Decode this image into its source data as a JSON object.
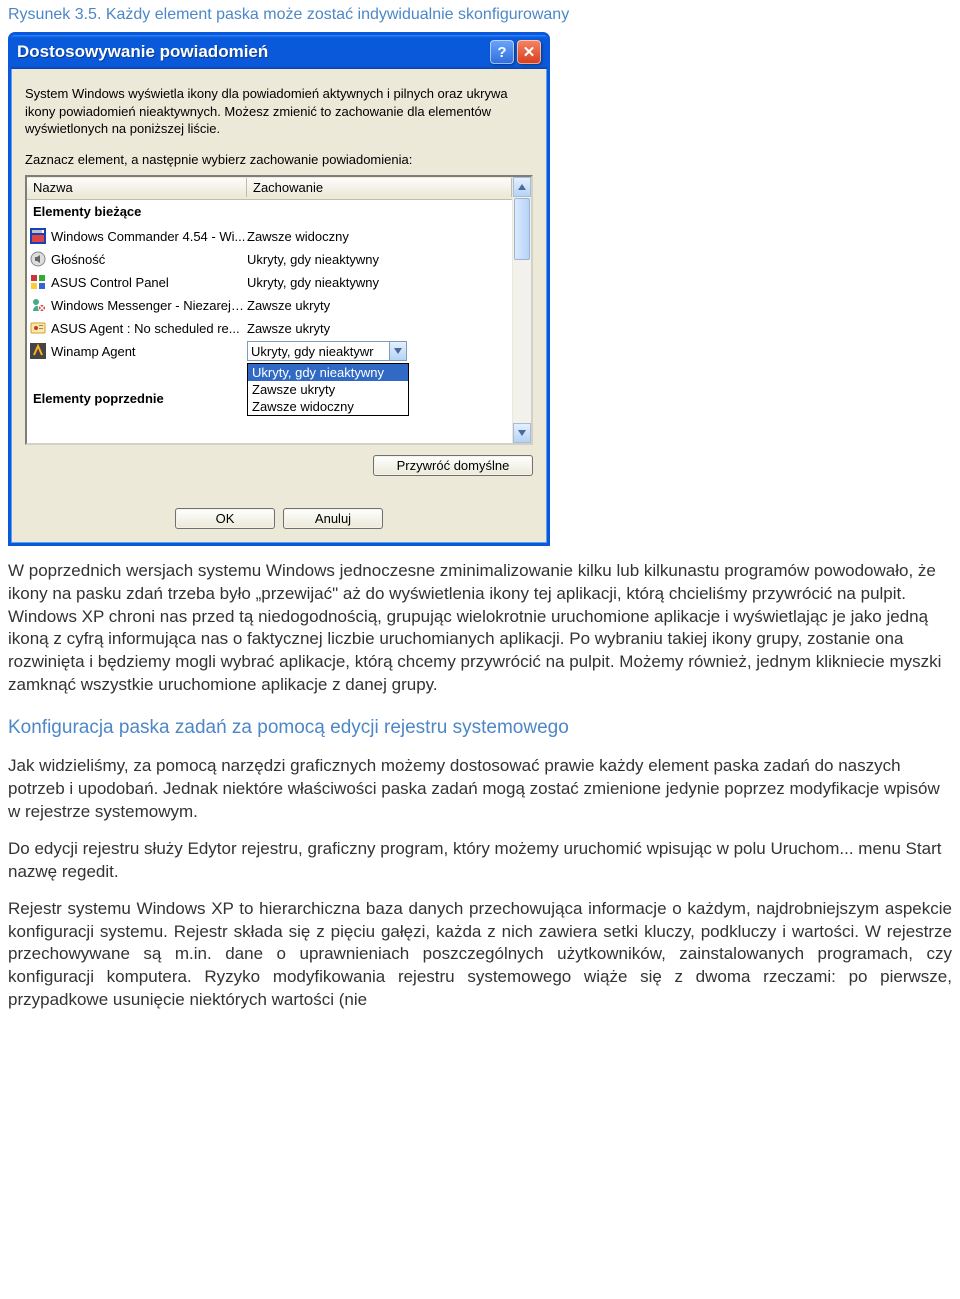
{
  "caption": "Rysunek 3.5. Każdy element paska może zostać indywidualnie skonfigurowany",
  "dialog": {
    "title": "Dostosowywanie powiadomień",
    "description": "System Windows wyświetla ikony dla powiadomień aktywnych i pilnych oraz ukrywa ikony powiadomień nieaktywnych. Możesz zmienić to zachowanie dla elementów wyświetlonych na poniższej liście.",
    "instruction": "Zaznacz element, a następnie wybierz zachowanie powiadomienia:",
    "columns": {
      "name": "Nazwa",
      "behavior": "Zachowanie"
    },
    "sections": {
      "current": "Elementy bieżące",
      "previous": "Elementy poprzednie"
    },
    "items": [
      {
        "name": "Windows Commander 4.54 - Wi...",
        "behavior": "Zawsze widoczny"
      },
      {
        "name": "Głośność",
        "behavior": "Ukryty, gdy nieaktywny"
      },
      {
        "name": "ASUS Control Panel",
        "behavior": "Ukryty, gdy nieaktywny"
      },
      {
        "name": "Windows Messenger - Niezareje...",
        "behavior": "Zawsze ukryty"
      },
      {
        "name": "ASUS Agent : No scheduled re...",
        "behavior": "Zawsze ukryty"
      },
      {
        "name": "Winamp Agent",
        "behavior": "Ukryty, gdy nieaktywr"
      }
    ],
    "dropdown_options": [
      "Ukryty, gdy nieaktywny",
      "Zawsze ukryty",
      "Zawsze widoczny"
    ],
    "restore_button": "Przywróć domyślne",
    "ok_button": "OK",
    "cancel_button": "Anuluj"
  },
  "article": {
    "p1": "W poprzednich wersjach systemu Windows jednoczesne zminimalizowanie kilku lub kilkunastu programów powodowało, że ikony na pasku zdań trzeba było „przewijać\" aż do wyświetlenia ikony tej aplikacji, którą chcieliśmy przywrócić na pulpit. Windows XP chroni nas przed tą niedogodnością, grupując wielokrotnie uruchomione aplikacje i wyświetlając je jako jedną ikoną z cyfrą informująca nas o faktycznej liczbie uruchomianych aplikacji. Po wybraniu takiej ikony grupy, zostanie ona rozwinięta i będziemy mogli wybrać aplikacje, którą chcemy przywrócić na pulpit. Możemy również, jednym klikniecie myszki zamknąć wszystkie uruchomione aplikacje z danej grupy.",
    "h2": "Konfiguracja paska zadań za pomocą edycji rejestru systemowego",
    "p2": "Jak widzieliśmy, za pomocą narzędzi graficznych możemy dostosować prawie każdy element paska zadań do naszych potrzeb i upodobań. Jednak niektóre właściwości paska zadań mogą zostać zmienione jedynie poprzez modyfikacje wpisów w rejestrze systemowym.",
    "p3_a": "Do edycji rejestru służy Edytor rejestru, graficzny program, który możemy uruchomić wpisując w polu ",
    "p3_mono1": "Uruchom",
    "p3_b": "... menu Start nazwę ",
    "p3_mono2": "regedit",
    "p3_c": ".",
    "p4": "Rejestr systemu Windows XP to hierarchiczna baza danych przechowująca informacje o każdym, najdrobniejszym aspekcie konfiguracji systemu. Rejestr składa się z pięciu gałęzi, każda z nich zawiera setki kluczy, podkluczy i wartości. W rejestrze przechowywane są m.in. dane o uprawnieniach poszczególnych użytkowników, zainstalowanych programach, czy konfiguracji komputera. Ryzyko modyfikowania rejestru systemowego wiąże się z dwoma rzeczami: po pierwsze, przypadkowe usunięcie niektórych wartości (nie"
  }
}
